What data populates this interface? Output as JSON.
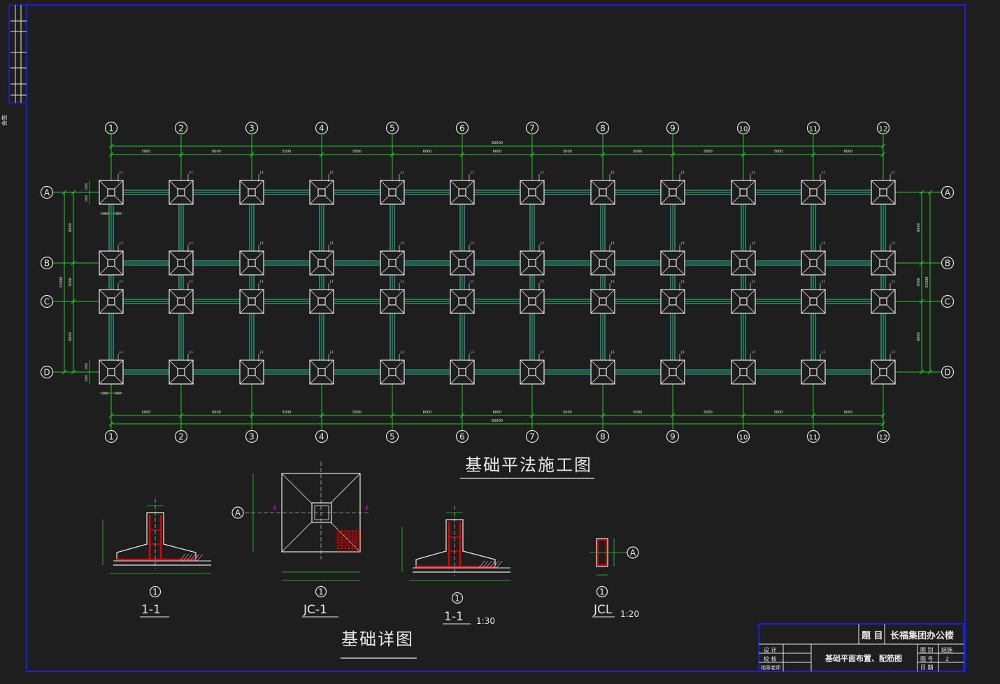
{
  "drawing": {
    "plan_title": "基础平法施工图",
    "detail_title": "基础详图",
    "background": "#1e1e1e",
    "colors": {
      "frame": "#1f1fd8",
      "axis": "#22cc22",
      "beam": "#2aa0b0",
      "footing": "#e8e8e8",
      "rebar": "#e00000",
      "tag": "#cc00cc",
      "dim": "#22cc22"
    }
  },
  "plan": {
    "col_axes": [
      "1",
      "2",
      "3",
      "4",
      "5",
      "6",
      "7",
      "8",
      "9",
      "10",
      "11",
      "12"
    ],
    "row_axes": [
      "A",
      "B",
      "C",
      "D"
    ],
    "bay_dims": [
      "5000",
      "6000",
      "5000",
      "5000",
      "6000",
      "6000",
      "5000",
      "6000",
      "5000",
      "5000",
      "6000",
      "5000"
    ],
    "total_dim": "60000",
    "side_dims": [
      "6000",
      "3000",
      "6000"
    ],
    "side_total": "15000",
    "footing_dims": [
      "1000",
      "1000"
    ],
    "footing_tag": "J-1"
  },
  "details": [
    {
      "axis_label": "1",
      "caption": "1-1",
      "scale": ""
    },
    {
      "axis_label": "1",
      "caption": "JC-1",
      "scale": "",
      "axis_mark": "A"
    },
    {
      "axis_label": "1",
      "caption": "1-1",
      "scale": "1:30"
    },
    {
      "axis_label": "1",
      "caption": "JCL",
      "scale": "1:20",
      "axis_mark": "A"
    }
  ],
  "title_block": {
    "label_project": "题 目",
    "project": "长福集团办公楼",
    "sheet_title": "基础平面布置、配筋图",
    "left_rows": [
      "设 计",
      "校 核",
      "指导老师"
    ],
    "right_labels": [
      "图 别",
      "图 号",
      "日 期"
    ],
    "right_values": [
      "结施",
      "2",
      ""
    ]
  },
  "corner_label": "会签"
}
